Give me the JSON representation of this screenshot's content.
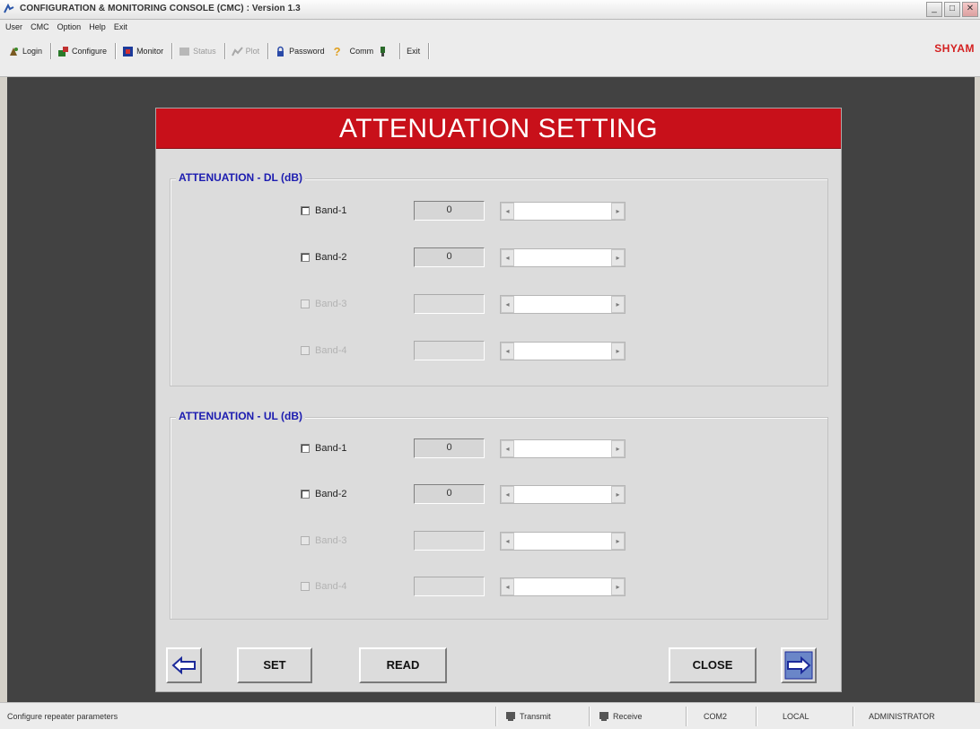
{
  "window": {
    "title": "CONFIGURATION & MONITORING CONSOLE (CMC) : Version 1.3",
    "minimize": "_",
    "maximize": "□",
    "close": "✕"
  },
  "menu": [
    "User",
    "CMC",
    "Option",
    "Help",
    "Exit"
  ],
  "toolbar": {
    "login": "Login",
    "configure": "Configure",
    "monitor": "Monitor",
    "status": "Status",
    "plot": "Plot",
    "password": "Password",
    "comm": "Comm",
    "exit": "Exit",
    "brand": "SHYAM"
  },
  "dialog": {
    "title": "ATTENUATION SETTING",
    "dl": {
      "title": "ATTENUATION - DL (dB)",
      "bands": [
        {
          "label": "Band-1",
          "value": "0",
          "enabled": true
        },
        {
          "label": "Band-2",
          "value": "0",
          "enabled": true
        },
        {
          "label": "Band-3",
          "value": "",
          "enabled": false
        },
        {
          "label": "Band-4",
          "value": "",
          "enabled": false
        }
      ]
    },
    "ul": {
      "title": "ATTENUATION - UL (dB)",
      "bands": [
        {
          "label": "Band-1",
          "value": "0",
          "enabled": true
        },
        {
          "label": "Band-2",
          "value": "0",
          "enabled": true
        },
        {
          "label": "Band-3",
          "value": "",
          "enabled": false
        },
        {
          "label": "Band-4",
          "value": "",
          "enabled": false
        }
      ]
    },
    "buttons": {
      "set": "SET",
      "read": "READ",
      "close": "CLOSE"
    }
  },
  "statusbar": {
    "message": "Configure repeater parameters",
    "transmit": "Transmit",
    "receive": "Receive",
    "port": "COM2",
    "mode": "LOCAL",
    "user": "ADMINISTRATOR"
  }
}
